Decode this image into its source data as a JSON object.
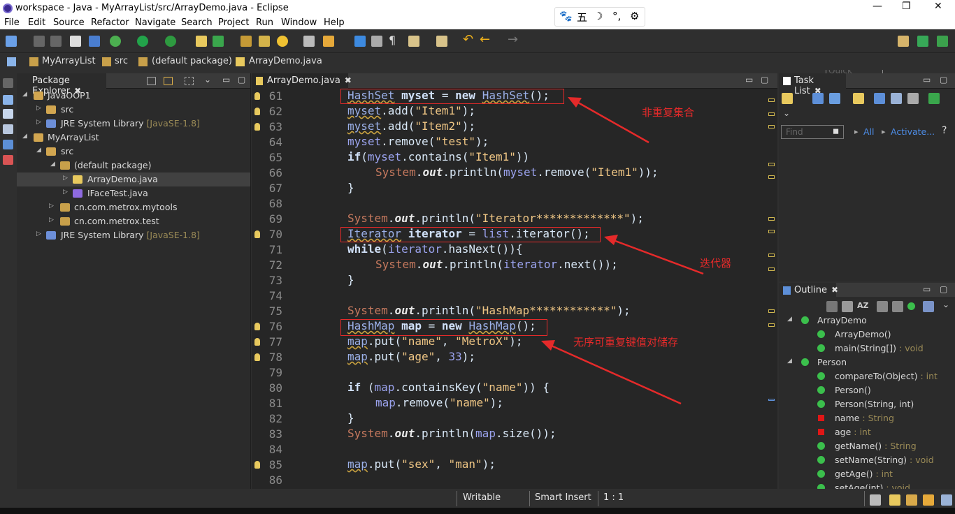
{
  "window": {
    "title": "workspace - Java - MyArrayList/src/ArrayDemo.java - Eclipse"
  },
  "ime": {
    "glyphs": [
      "五"
    ]
  },
  "menu": [
    "File",
    "Edit",
    "Source",
    "Refactor",
    "Navigate",
    "Search",
    "Project",
    "Run",
    "Window",
    "Help"
  ],
  "toolbar": {
    "quick_access_placeholder": "Quick Access"
  },
  "breadcrumb": [
    "MyArrayList",
    "src",
    "(default package)",
    "ArrayDemo.java"
  ],
  "package_explorer": {
    "title": "Package Explorer",
    "items": [
      {
        "label": "JavaOOP1",
        "suffix": ""
      },
      {
        "label": "src",
        "suffix": ""
      },
      {
        "label": "JRE System Library",
        "suffix": "[JavaSE-1.8]"
      },
      {
        "label": "MyArrayList",
        "suffix": ""
      },
      {
        "label": "src",
        "suffix": ""
      },
      {
        "label": "(default package)",
        "suffix": ""
      },
      {
        "label": "ArrayDemo.java",
        "suffix": ""
      },
      {
        "label": "IFaceTest.java",
        "suffix": ""
      },
      {
        "label": "cn.com.metrox.mytools",
        "suffix": ""
      },
      {
        "label": "cn.com.metrox.test",
        "suffix": ""
      },
      {
        "label": "JRE System Library",
        "suffix": "[JavaSE-1.8]"
      }
    ]
  },
  "editor": {
    "tab": "ArrayDemo.java",
    "line_numbers": [
      "61",
      "62",
      "63",
      "64",
      "65",
      "66",
      "67",
      "68",
      "69",
      "70",
      "71",
      "72",
      "73",
      "74",
      "75",
      "76",
      "77",
      "78",
      "79",
      "80",
      "81",
      "82",
      "83",
      "84",
      "85",
      "86"
    ]
  },
  "annotations": [
    "非重复集合",
    "迭代器",
    "无序可重复键值对储存"
  ],
  "task_list": {
    "title": "Task List",
    "find_placeholder": "Find",
    "all": "All",
    "activate": "Activate..."
  },
  "outline": {
    "title": "Outline",
    "items": [
      {
        "label": "ArrayDemo",
        "type": ""
      },
      {
        "label": "ArrayDemo()",
        "type": ""
      },
      {
        "label": "main(String[])",
        "type": " : void"
      },
      {
        "label": "Person",
        "type": ""
      },
      {
        "label": "compareTo(Object)",
        "type": " : int"
      },
      {
        "label": "Person()",
        "type": ""
      },
      {
        "label": "Person(String, int)",
        "type": ""
      },
      {
        "label": "name",
        "type": " : String"
      },
      {
        "label": "age",
        "type": " : int"
      },
      {
        "label": "getName()",
        "type": " : String"
      },
      {
        "label": "setName(String)",
        "type": " : void"
      },
      {
        "label": "getAge()",
        "type": " : int"
      },
      {
        "label": "setAge(int)",
        "type": " : void"
      }
    ]
  },
  "status": {
    "writable": "Writable",
    "insert_mode": "Smart Insert",
    "position": "1 : 1"
  },
  "colors": {
    "annotation_red": "#e52a2a",
    "keyword": "#cc6c1d",
    "string": "#eec584"
  }
}
